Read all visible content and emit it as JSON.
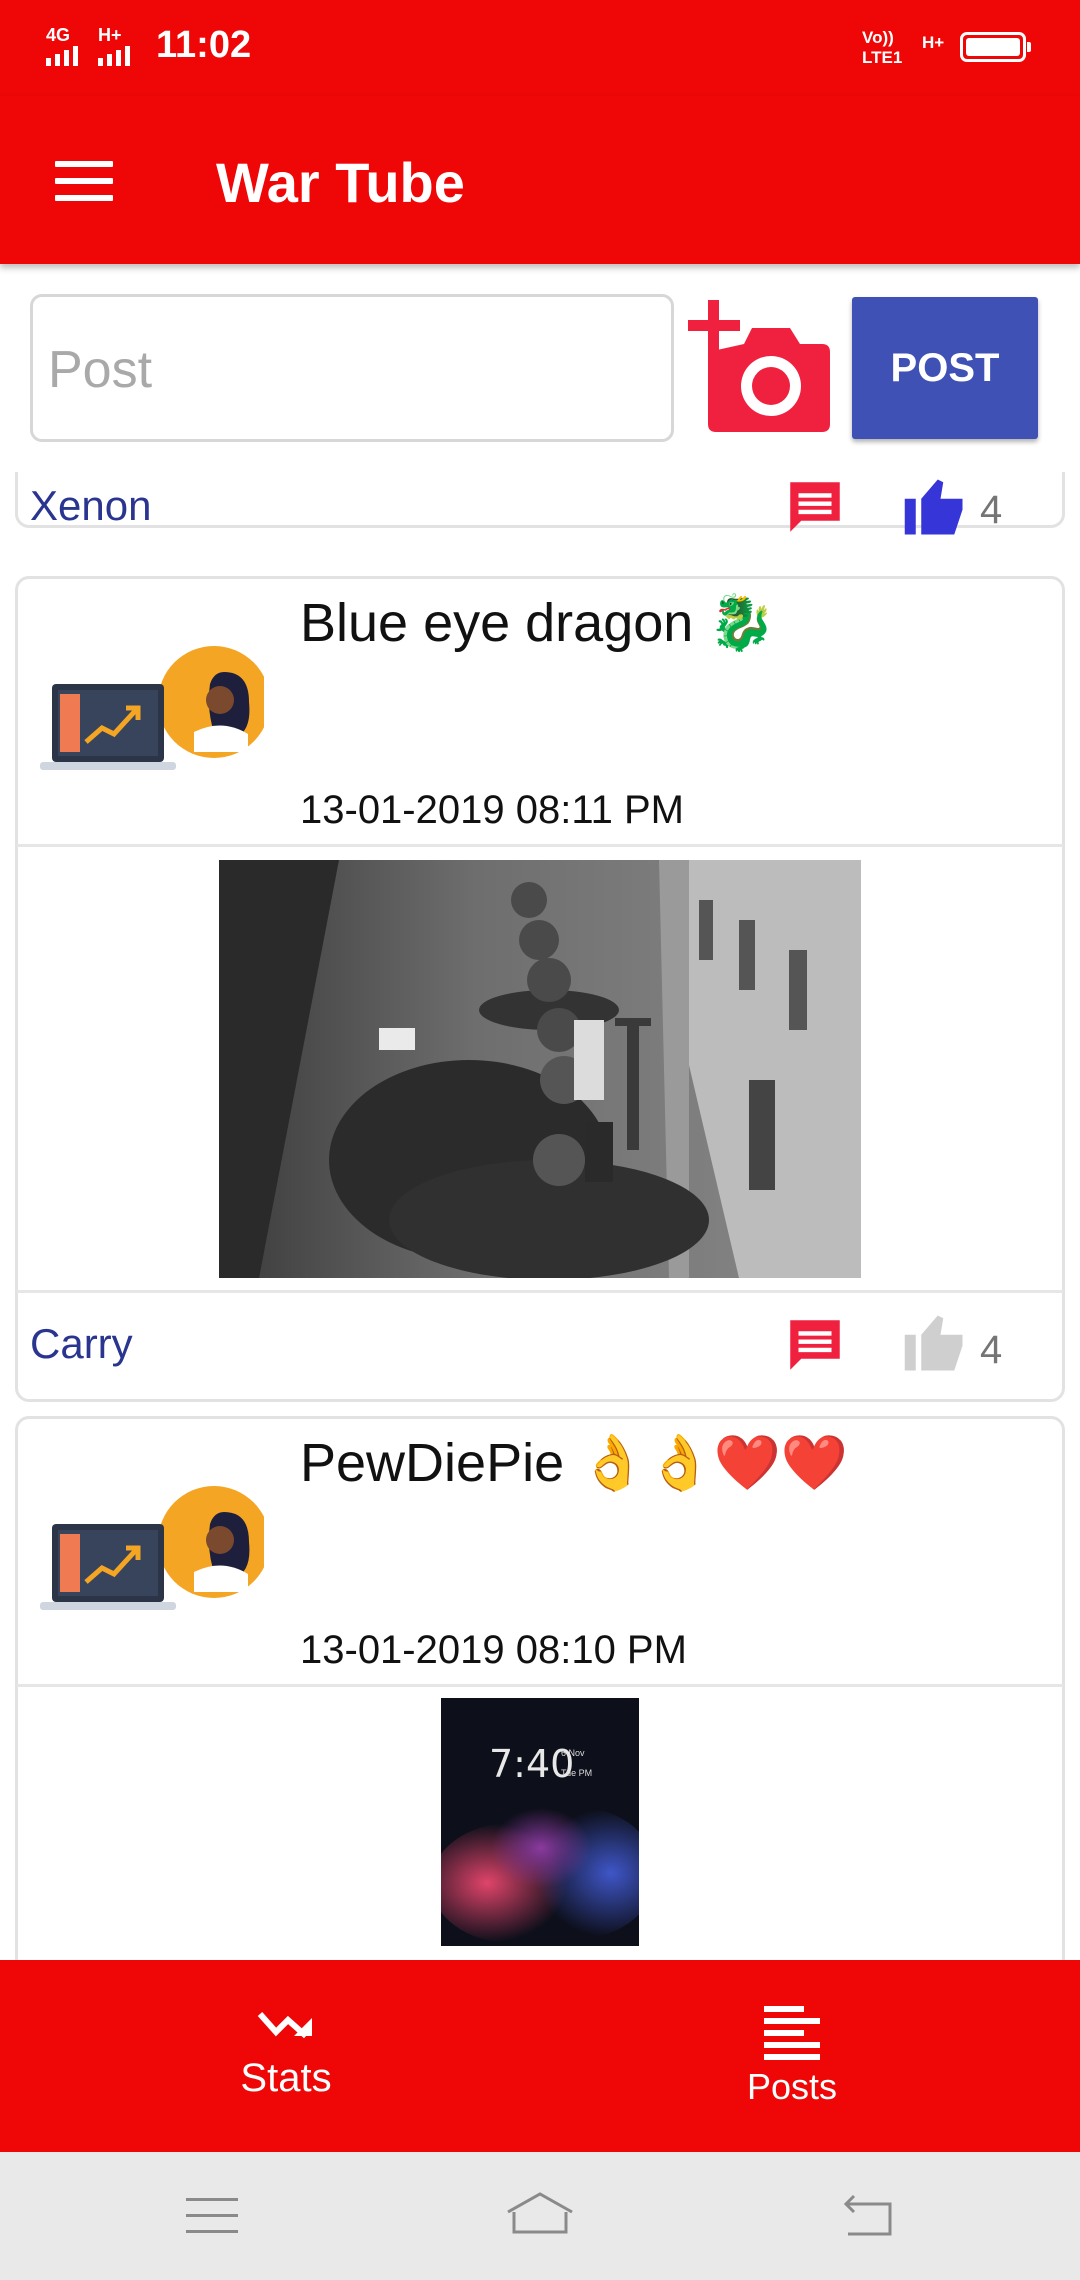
{
  "status_bar": {
    "time": "11:02",
    "network_left_1": "4G",
    "network_left_2": "H+",
    "network_right_1": "Vo)) LTE1",
    "network_right_2": "H+"
  },
  "app_bar": {
    "title": "War Tube",
    "menu_icon": "hamburger-menu-icon"
  },
  "composer": {
    "placeholder": "Post",
    "camera_icon": "add-photo-icon",
    "post_button_label": "POST"
  },
  "feed": {
    "partial_post": {
      "author": "Xenon",
      "likes": "4",
      "liked": true
    },
    "posts": [
      {
        "title": "Blue eye dragon 🐉",
        "date": "13-01-2019 08:11 PM",
        "author": "Carry",
        "likes": "4",
        "liked": false
      },
      {
        "title": "PewDiePie 👌👌❤️❤️",
        "date": "13-01-2019 08:10 PM"
      }
    ],
    "phone_image": {
      "clock": "7:40",
      "date_line_1": "6 Nov",
      "date_line_2": "Tue PM"
    }
  },
  "bottom_nav": {
    "stats_label": "Stats",
    "posts_label": "Posts"
  },
  "colors": {
    "primary": "#ef0707",
    "accent": "#3f51b5",
    "author_text": "#2a3590",
    "comment_icon": "#f0213f",
    "liked_icon": "#3535d8",
    "unliked_icon": "#cfcfcf"
  }
}
